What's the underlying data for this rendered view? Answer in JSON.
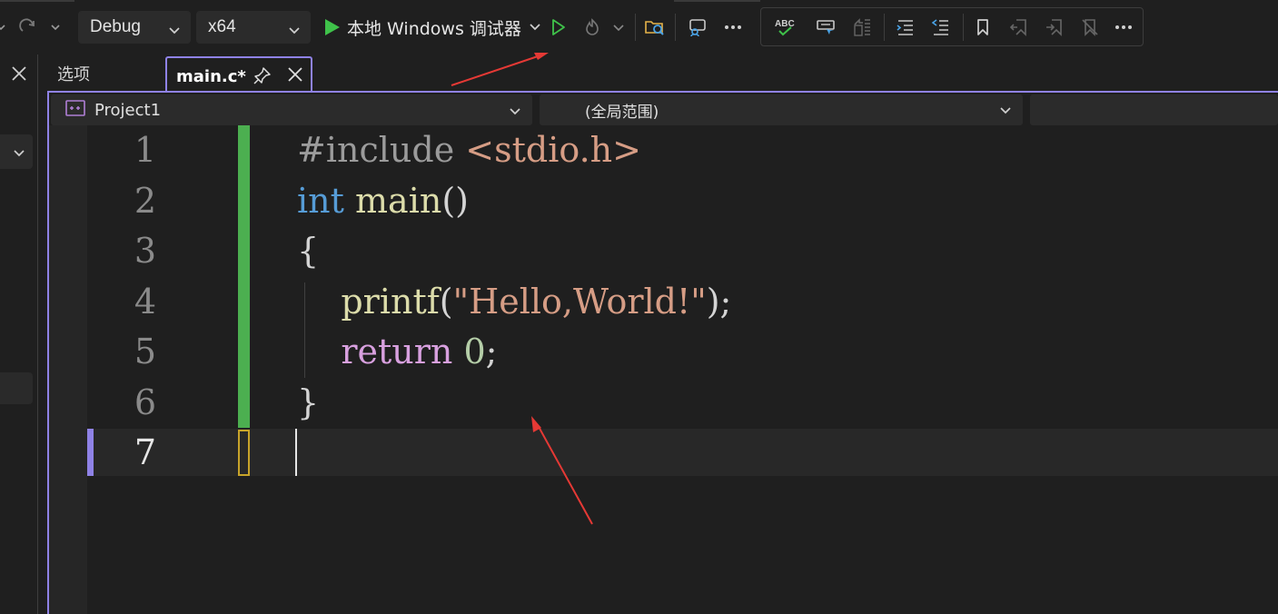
{
  "toolbar": {
    "config_dropdown": "Debug",
    "platform_dropdown": "x64",
    "run_label": "本地 Windows 调试器"
  },
  "tabs": {
    "inactive_label": "选项",
    "active_label": "main.c*"
  },
  "navbar": {
    "project": "Project1",
    "scope": "(全局范围)"
  },
  "editor": {
    "line_numbers": [
      "1",
      "2",
      "3",
      "4",
      "5",
      "6",
      "7"
    ],
    "current_line": "7",
    "code": {
      "line1": {
        "directive": "#include",
        "header": "<stdio.h>"
      },
      "line2": {
        "keyword": "int",
        "function": "main",
        "paren": "()"
      },
      "line3": {
        "brace": "{"
      },
      "line4": {
        "function": "printf",
        "open": "(",
        "string": "\"Hello,World!\"",
        "close": ");"
      },
      "line5": {
        "keyword": "return",
        "number": "0",
        "semi": ";"
      },
      "line6": {
        "brace": "}"
      }
    }
  },
  "colors": {
    "accent": "#8f82e6",
    "change_bar": "#4caf50",
    "run_green": "#3fc24a",
    "annotation_arrow": "#e53935"
  },
  "icons": [
    "undo-icon",
    "redo-icon",
    "play-icon",
    "hot-reload-icon",
    "find-in-files-icon",
    "live-share-icon",
    "more-icon",
    "spell-check-icon",
    "comment-icon",
    "uncomment-icon",
    "decrease-indent-icon",
    "increase-indent-icon",
    "bookmark-icon",
    "prev-bookmark-icon",
    "next-bookmark-icon",
    "clear-bookmarks-icon",
    "pin-icon",
    "close-icon",
    "project-icon",
    "chevron-down-icon"
  ]
}
